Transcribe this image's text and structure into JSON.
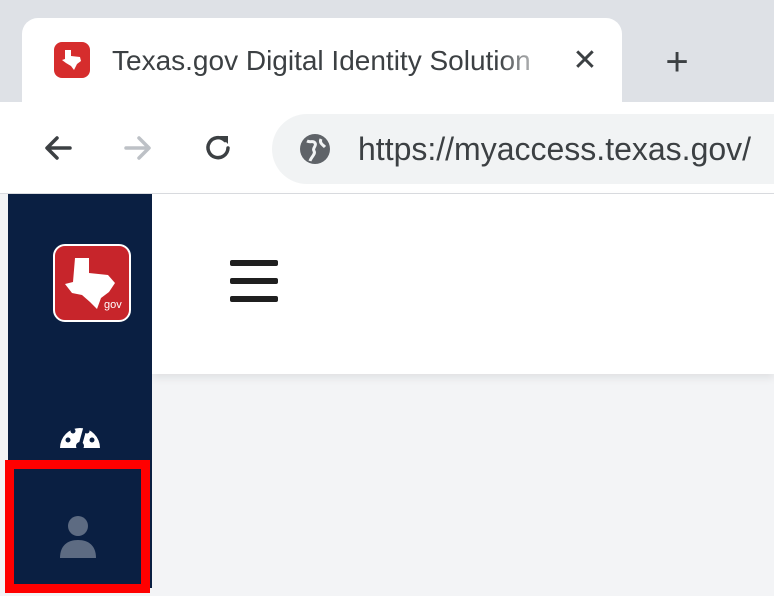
{
  "browser": {
    "tab": {
      "title": "Texas.gov Digital Identity Solution",
      "favicon": "texas-gov-favicon",
      "close_symbol": "✕"
    },
    "new_tab_symbol": "+",
    "address": {
      "url": "https://myaccess.texas.gov/"
    }
  },
  "page": {
    "sidebar": {
      "logo": "texas-gov-logo",
      "logo_text": "gov",
      "items": [
        {
          "icon": "dashboard-gauge-icon"
        },
        {
          "icon": "user-profile-icon",
          "highlighted": true
        }
      ],
      "bg_color": "#0a1f42"
    },
    "header": {
      "menu_icon": "hamburger-menu-icon"
    }
  },
  "colors": {
    "brand_red": "#c7252b",
    "highlight": "#ff0000",
    "sidebar_bg": "#0a1f42"
  }
}
